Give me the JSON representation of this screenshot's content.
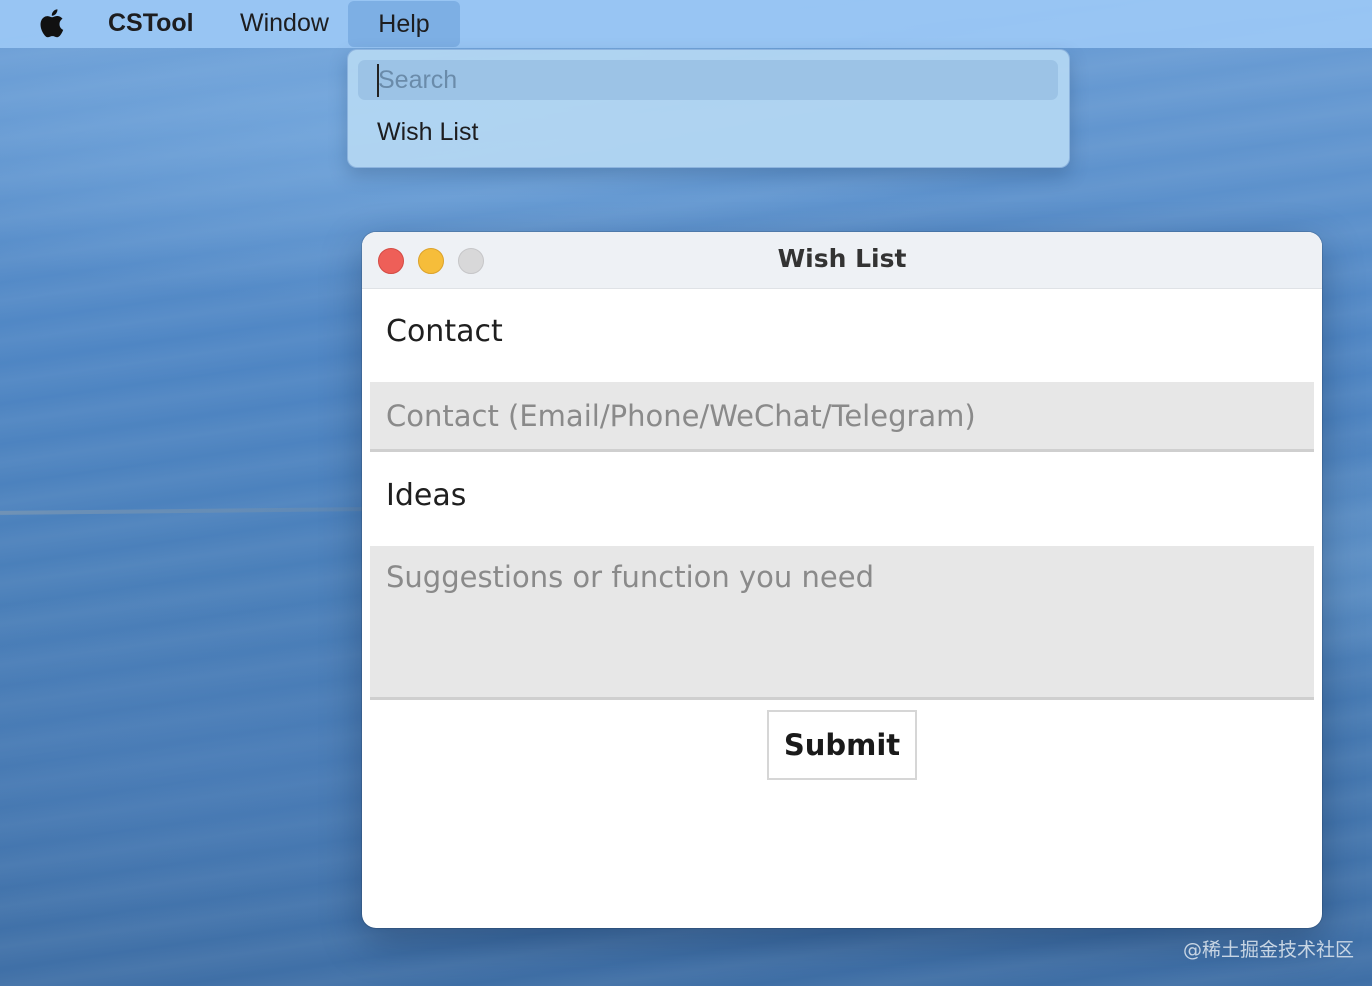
{
  "menubar": {
    "apple_icon": "apple-logo-icon",
    "app_name": "CSTool",
    "items": [
      "Window",
      "Help"
    ]
  },
  "help_menu": {
    "search_placeholder": "Search",
    "items": [
      "Wish List"
    ]
  },
  "window": {
    "title": "Wish List",
    "contact_label": "Contact",
    "contact_placeholder": "Contact (Email/Phone/WeChat/Telegram)",
    "ideas_label": "Ideas",
    "ideas_placeholder": "Suggestions or function you need",
    "submit_label": "Submit"
  },
  "watermark": "@稀土掘金技术社区",
  "colors": {
    "close": "#ee5f58",
    "minimize": "#f6bd3a",
    "zoom": "#d8d8d9",
    "menubar": "#9bc8f5"
  }
}
